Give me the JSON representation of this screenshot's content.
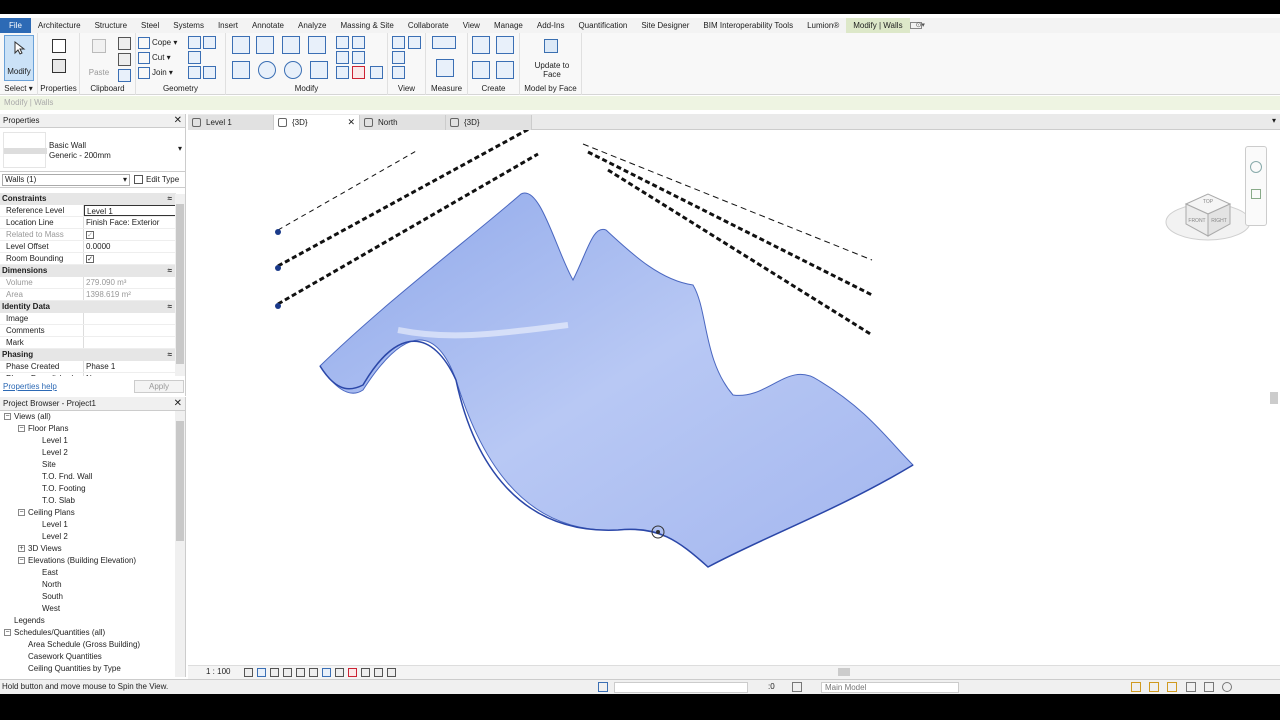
{
  "ribbon": {
    "tabs": [
      "File",
      "Architecture",
      "Structure",
      "Steel",
      "Systems",
      "Insert",
      "Annotate",
      "Analyze",
      "Massing & Site",
      "Collaborate",
      "View",
      "Manage",
      "Add-Ins",
      "Quantification",
      "Site Designer",
      "BIM Interoperability Tools",
      "Lumion®",
      "Modify | Walls"
    ],
    "active_tab": "Modify | Walls",
    "panels": {
      "modify_label": "Modify",
      "select_label": "Select ▾",
      "properties_label": "Properties",
      "paste_label": "Paste",
      "clipboard_label": "Clipboard",
      "cope_label": "Cope",
      "cut_label": "Cut",
      "join_label": "Join",
      "geometry_label": "Geometry",
      "modify_panel_label": "Modify",
      "view_label": "View",
      "measure_label": "Measure",
      "create_label": "Create",
      "update_to_face_label": "Update to Face",
      "model_by_face_label": "Model by Face"
    }
  },
  "options_bar": {
    "text": "Modify | Walls"
  },
  "properties": {
    "title": "Properties",
    "type_family": "Basic Wall",
    "type_name": "Generic - 200mm",
    "instance_selector": "Walls (1)",
    "edit_type": "Edit Type",
    "groups": [
      {
        "name": "Constraints",
        "rows": [
          {
            "key": "Reference Level",
            "value": "Level 1",
            "dim": false,
            "editing": true
          },
          {
            "key": "Location Line",
            "value": "Finish Face: Exterior",
            "dim": false
          },
          {
            "key": "Related to Mass",
            "value": "",
            "dim": true,
            "check": true
          },
          {
            "key": "Level Offset",
            "value": "0.0000",
            "dim": false
          },
          {
            "key": "Room Bounding",
            "value": "",
            "dim": false,
            "check": true
          }
        ]
      },
      {
        "name": "Dimensions",
        "rows": [
          {
            "key": "Volume",
            "value": "279.090 m³",
            "dim": true
          },
          {
            "key": "Area",
            "value": "1398.619 m²",
            "dim": true
          }
        ]
      },
      {
        "name": "Identity Data",
        "rows": [
          {
            "key": "Image",
            "value": ""
          },
          {
            "key": "Comments",
            "value": ""
          },
          {
            "key": "Mark",
            "value": ""
          }
        ]
      },
      {
        "name": "Phasing",
        "rows": [
          {
            "key": "Phase Created",
            "value": "Phase 1"
          },
          {
            "key": "Phase Demolished",
            "value": "None"
          }
        ]
      }
    ],
    "help_link": "Properties help",
    "apply": "Apply"
  },
  "browser": {
    "title": "Project Browser - Project1",
    "tree": [
      {
        "label": "Views (all)",
        "depth": 0,
        "toggle": "−"
      },
      {
        "label": "Floor Plans",
        "depth": 1,
        "toggle": "−"
      },
      {
        "label": "Level 1",
        "depth": 2
      },
      {
        "label": "Level 2",
        "depth": 2
      },
      {
        "label": "Site",
        "depth": 2
      },
      {
        "label": "T.O. Fnd. Wall",
        "depth": 2
      },
      {
        "label": "T.O. Footing",
        "depth": 2
      },
      {
        "label": "T.O. Slab",
        "depth": 2
      },
      {
        "label": "Ceiling Plans",
        "depth": 1,
        "toggle": "−"
      },
      {
        "label": "Level 1",
        "depth": 2
      },
      {
        "label": "Level 2",
        "depth": 2
      },
      {
        "label": "3D Views",
        "depth": 1,
        "toggle": "+"
      },
      {
        "label": "Elevations (Building Elevation)",
        "depth": 1,
        "toggle": "−"
      },
      {
        "label": "East",
        "depth": 2
      },
      {
        "label": "North",
        "depth": 2
      },
      {
        "label": "South",
        "depth": 2
      },
      {
        "label": "West",
        "depth": 2
      },
      {
        "label": "Legends",
        "depth": 0
      },
      {
        "label": "Schedules/Quantities (all)",
        "depth": 0,
        "toggle": "−"
      },
      {
        "label": "Area Schedule (Gross Building)",
        "depth": 1
      },
      {
        "label": "Casework Quantities",
        "depth": 1
      },
      {
        "label": "Ceiling Quantities by Type",
        "depth": 1
      }
    ]
  },
  "view_tabs": [
    {
      "label": "Level 1",
      "active": false
    },
    {
      "label": "{3D}",
      "active": true
    },
    {
      "label": "North",
      "active": false
    },
    {
      "label": "{3D}",
      "active": false
    }
  ],
  "view_bar": {
    "scale": "1 : 100"
  },
  "viewcube": {
    "top": "TOP",
    "front": "FRONT",
    "right": "RIGHT"
  },
  "status": {
    "hint": "Hold button and move mouse to Spin the View.",
    "worksets": ":0",
    "model": "Main Model"
  },
  "colors": {
    "accent": "#2d6ab5",
    "context_tab": "#dde8c9",
    "surface": "#a9bdf0"
  }
}
